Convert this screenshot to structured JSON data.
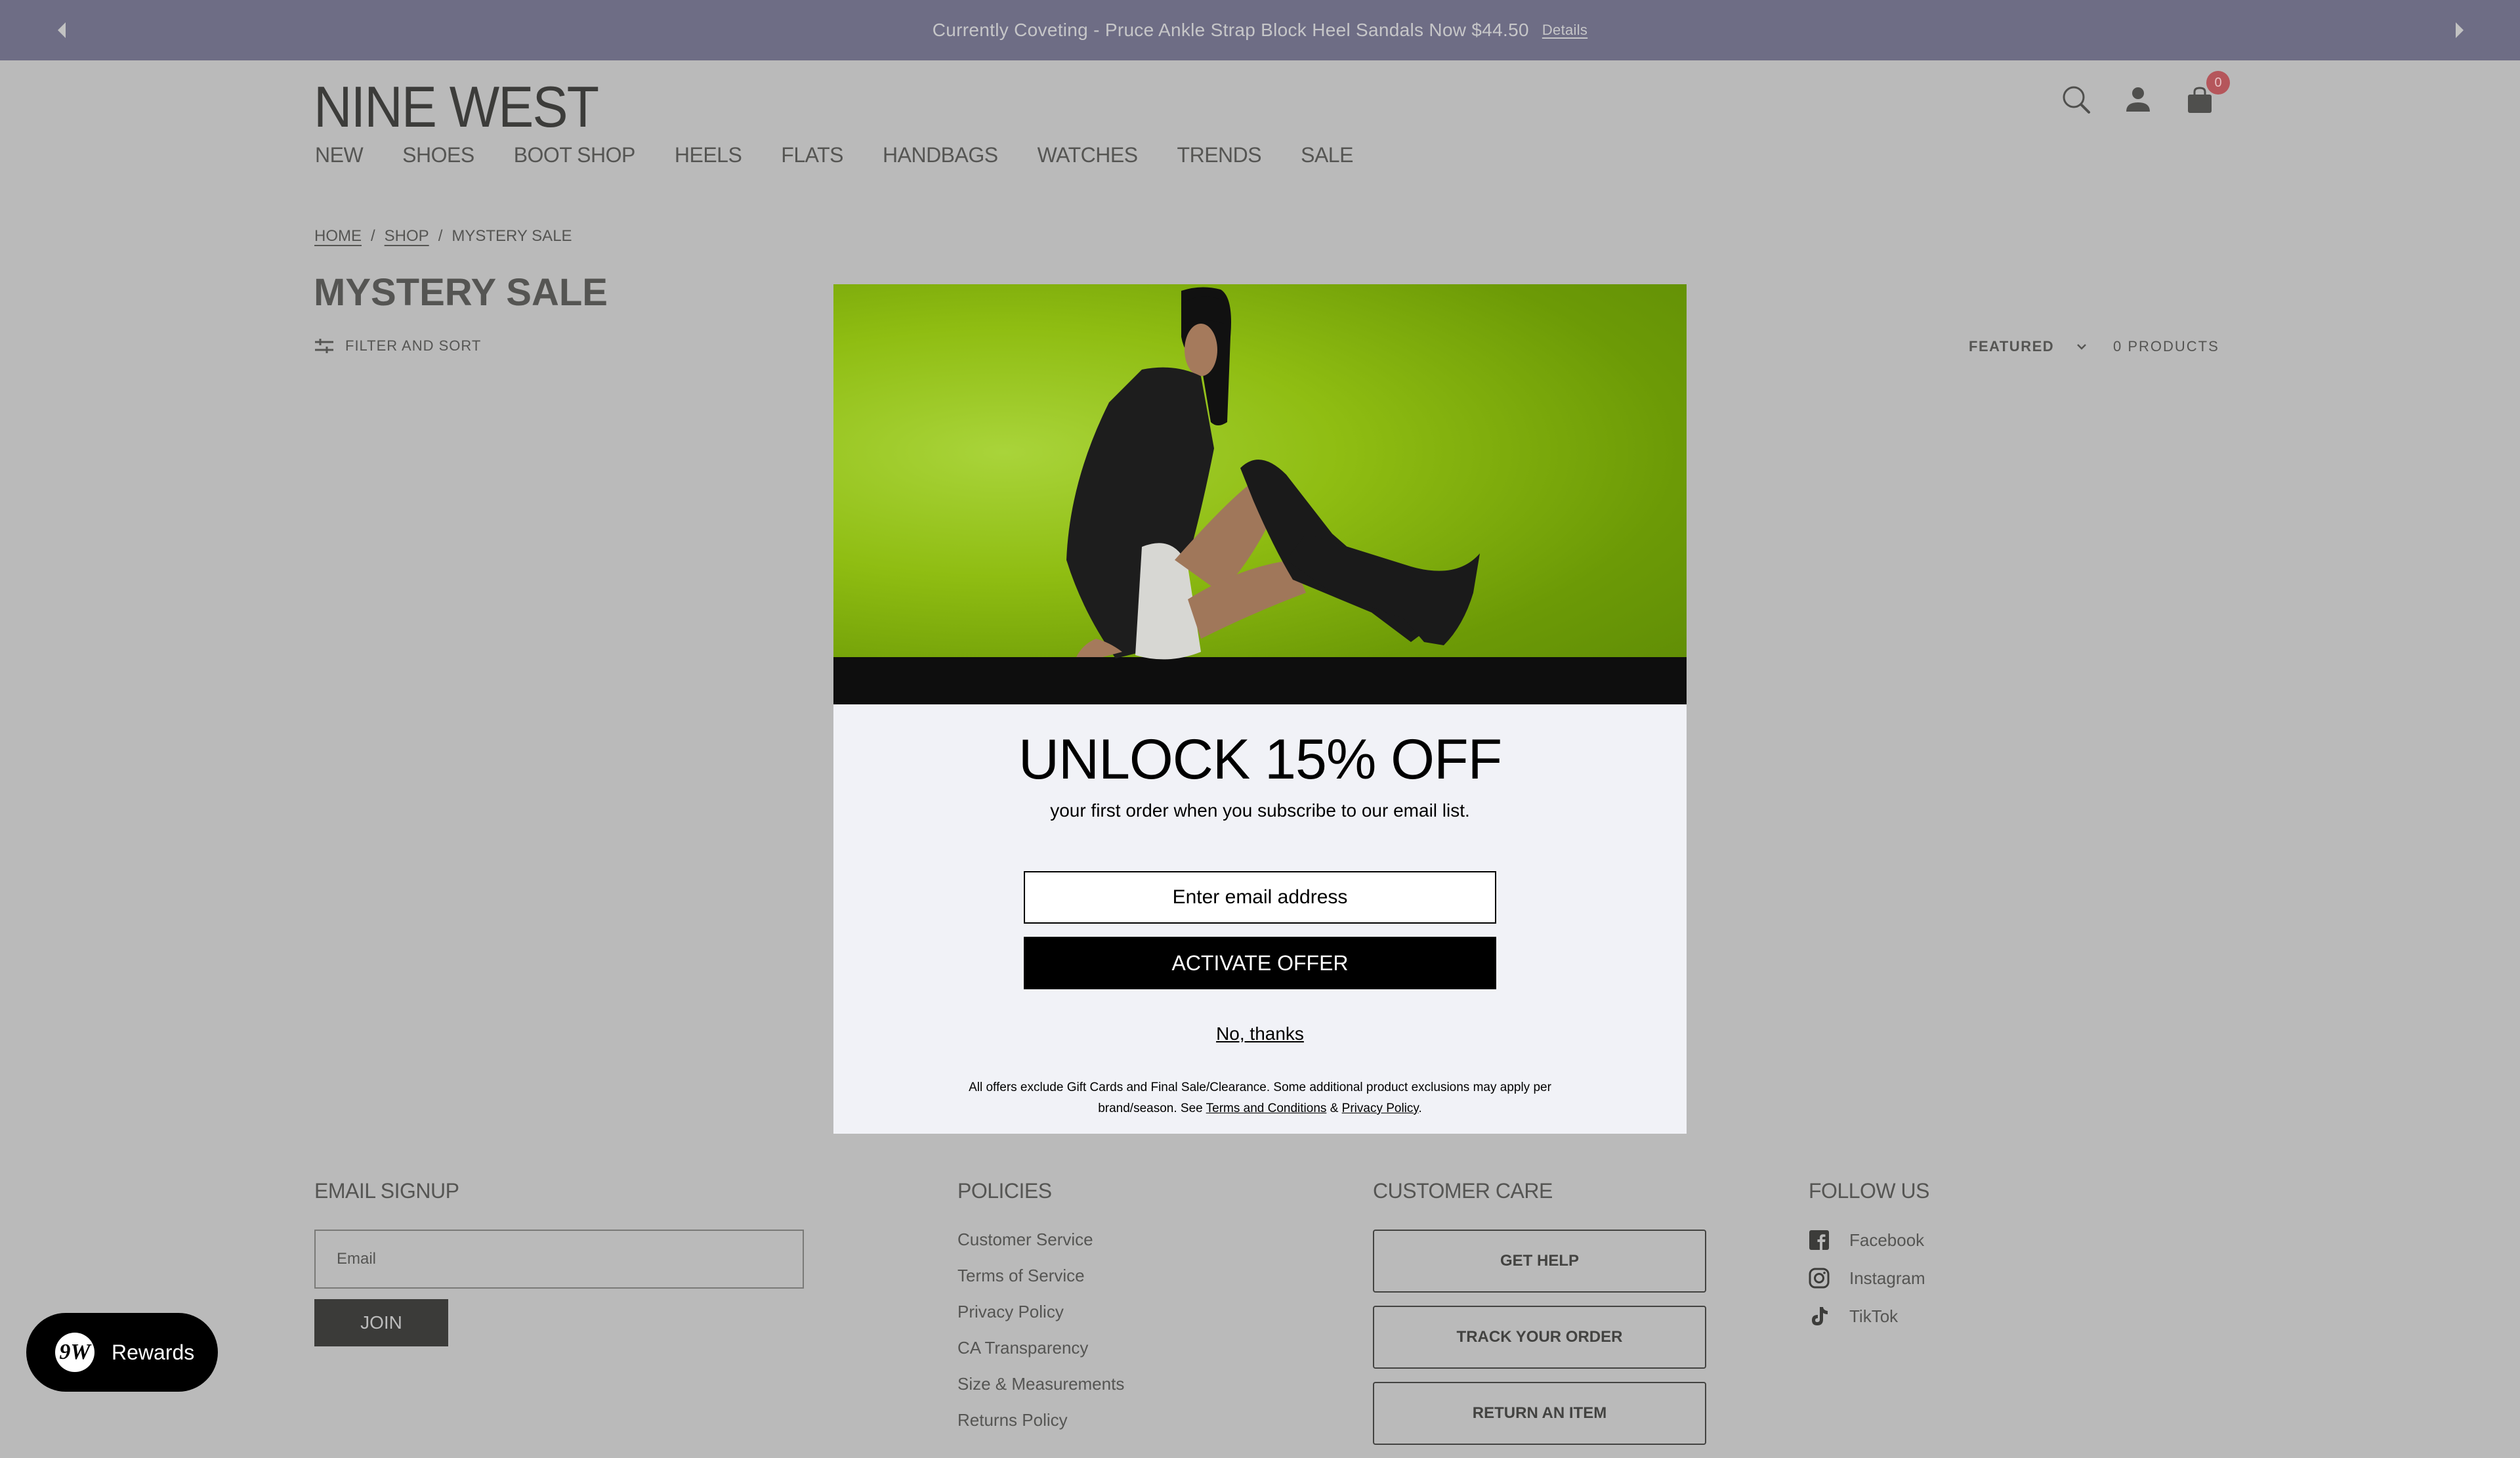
{
  "announcement": {
    "text": "Currently Coveting - Pruce Ankle Strap Block Heel Sandals Now $44.50",
    "details_label": "Details"
  },
  "header": {
    "logo": "NINE WEST",
    "nav": [
      "NEW",
      "SHOES",
      "BOOT SHOP",
      "HEELS",
      "FLATS",
      "HANDBAGS",
      "WATCHES",
      "TRENDS",
      "SALE"
    ],
    "cart_count": "0",
    "icons": [
      "search-icon",
      "account-icon",
      "shopping-bag-icon"
    ]
  },
  "breadcrumb": {
    "home": "HOME",
    "shop": "SHOP",
    "current": "MYSTERY SALE",
    "separator": "/"
  },
  "collection": {
    "title": "MYSTERY SALE",
    "filter_label": "FILTER AND SORT",
    "sort_selected": "FEATURED",
    "product_count": "0 PRODUCTS"
  },
  "modal": {
    "headline": "UNLOCK 15% OFF",
    "subheadline": "your first order when you subscribe to our email list.",
    "email_placeholder": "Enter email address",
    "cta": "ACTIVATE OFFER",
    "dismiss": "No, thanks",
    "legal_text_1": "All offers exclude Gift Cards and Final Sale/Clearance. Some additional product exclusions may apply per brand/season. See ",
    "legal_terms": "Terms and Conditions",
    "legal_amp": " & ",
    "legal_privacy": "Privacy Policy",
    "legal_end": "."
  },
  "footer": {
    "email_signup": {
      "heading": "EMAIL SIGNUP",
      "placeholder": "Email",
      "button": "JOIN"
    },
    "policies": {
      "heading": "POLICIES",
      "links": [
        "Customer Service",
        "Terms of Service",
        "Privacy Policy",
        "CA Transparency",
        "Size & Measurements",
        "Returns Policy"
      ]
    },
    "customer_care": {
      "heading": "CUSTOMER CARE",
      "buttons": [
        "GET HELP",
        "TRACK YOUR ORDER",
        "RETURN AN ITEM"
      ]
    },
    "follow_us": {
      "heading": "FOLLOW US",
      "links": [
        "Facebook",
        "Instagram",
        "TikTok"
      ]
    }
  },
  "rewards": {
    "label": "Rewards",
    "logo_text": "9W"
  },
  "colors": {
    "announcement_bg": "#6e6d85",
    "page_bg": "#bababa",
    "modal_bg": "#f1f2f7",
    "badge": "#b5565b",
    "cta_bg": "#000000"
  }
}
